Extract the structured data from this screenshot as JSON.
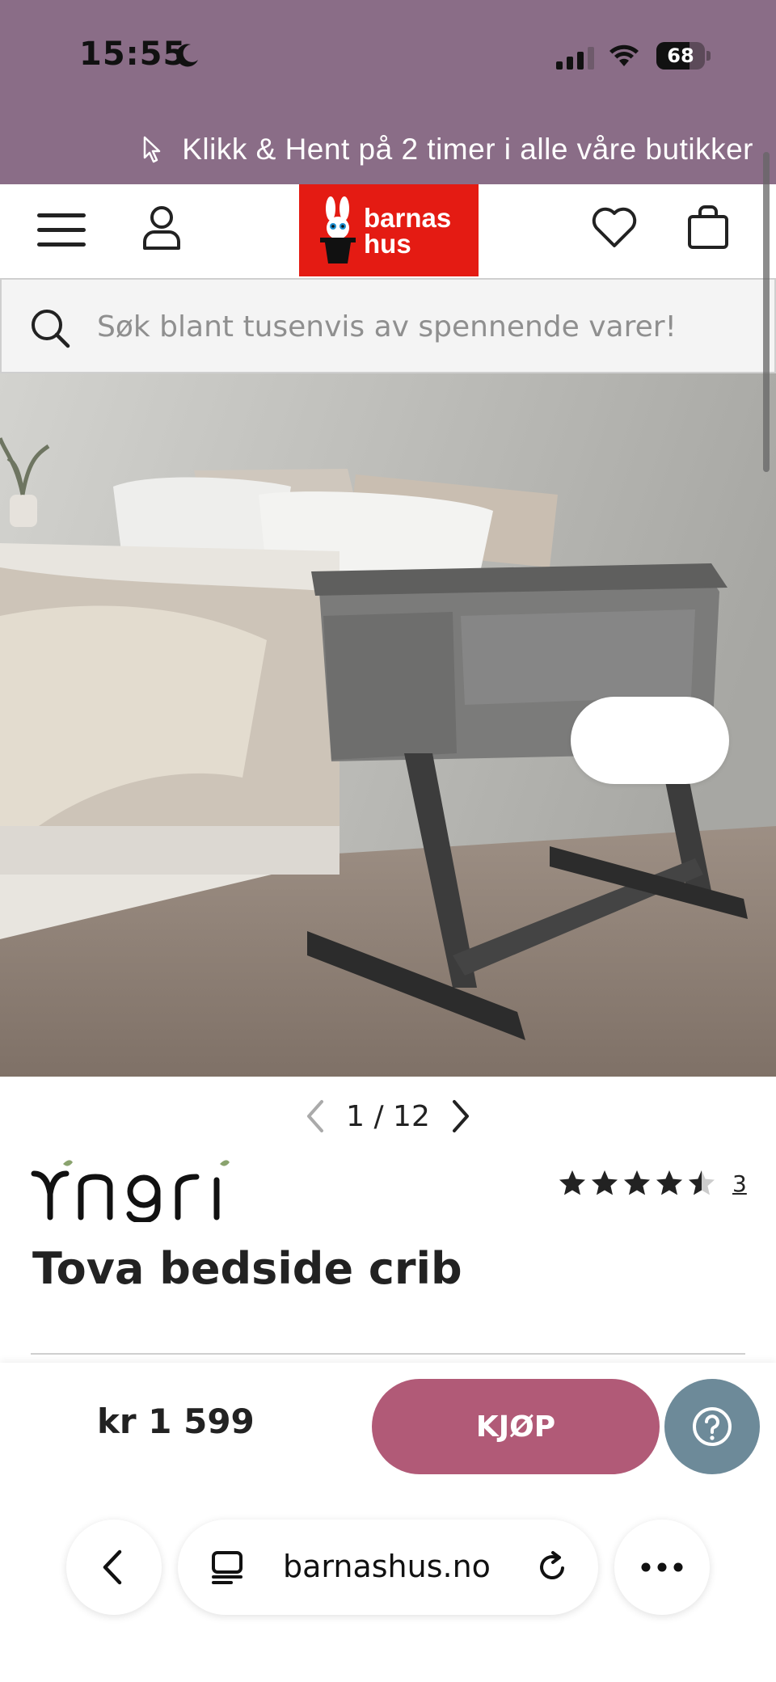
{
  "status_bar": {
    "time": "15:55",
    "battery": "68",
    "battery_level": 0.68
  },
  "promo": {
    "text": "Klikk & Hent på 2 timer i alle våre butikker"
  },
  "header": {
    "logo_line1": "barnas",
    "logo_line2": "hus",
    "logo_color": "#e41b13"
  },
  "search": {
    "placeholder": "Søk blant tusenvis av spennende varer!"
  },
  "gallery": {
    "pager_text": "1 / 12",
    "current": 1,
    "total": 12
  },
  "product": {
    "brand": "Yngri",
    "title": "Tova bedside crib",
    "rating": 4.5,
    "review_count": "3"
  },
  "buybar": {
    "price": "kr 1 599",
    "buy_label": "KJØP",
    "buy_color": "#b15a77",
    "help_color": "#6d8a99"
  },
  "browser": {
    "url": "barnashus.no"
  },
  "colors": {
    "top_bar": "#8a6d87"
  }
}
